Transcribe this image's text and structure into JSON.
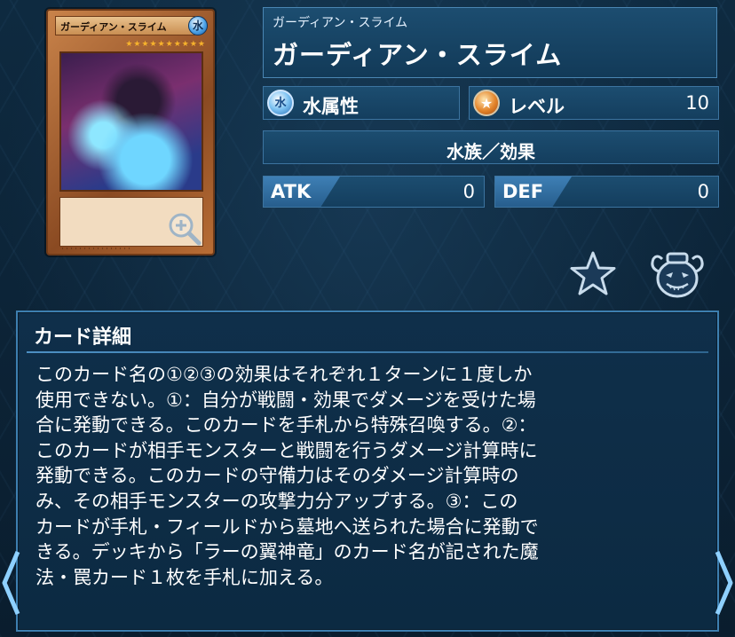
{
  "card": {
    "strip_name": "ガーディアン・スライム",
    "attribute_glyph": "水",
    "stars": "★★★★★★★★★★",
    "footer_text": "・・・・・・・・・・・・・・・・"
  },
  "header": {
    "ruby": "ガーディアン・スライム",
    "name": "ガーディアン・スライム"
  },
  "attribute": {
    "icon_glyph": "水",
    "label": "水属性",
    "icon": "water-icon"
  },
  "level": {
    "label": "レベル",
    "value": "10",
    "icon": "level-star-icon"
  },
  "type_line": "水族／効果",
  "stats": {
    "atk_label": "ATK",
    "atk_value": "0",
    "def_label": "DEF",
    "def_value": "0"
  },
  "details": {
    "title": "カード詳細",
    "text": "このカード名の①②③の効果はそれぞれ１ターンに１度しか\n使用できない。①：自分が戦闘・効果でダメージを受けた場\n合に発動できる。このカードを手札から特殊召喚する。②：\nこのカードが相手モンスターと戦闘を行うダメージ計算時に\n発動できる。このカードの守備力はそのダメージ計算時の\nみ、その相手モンスターの攻撃力分アップする。③：この\nカードが手札・フィールドから墓地へ送られた場合に発動で\nきる。デッキから「ラーの翼神竜」のカード名が記された魔\n法・罠カード１枚を手札に加える。"
  },
  "colors": {
    "background": "#0c2336",
    "panel": "#1c4d70",
    "panel_border": "#3c74a0",
    "stat_tag": "#3e7fb5"
  }
}
